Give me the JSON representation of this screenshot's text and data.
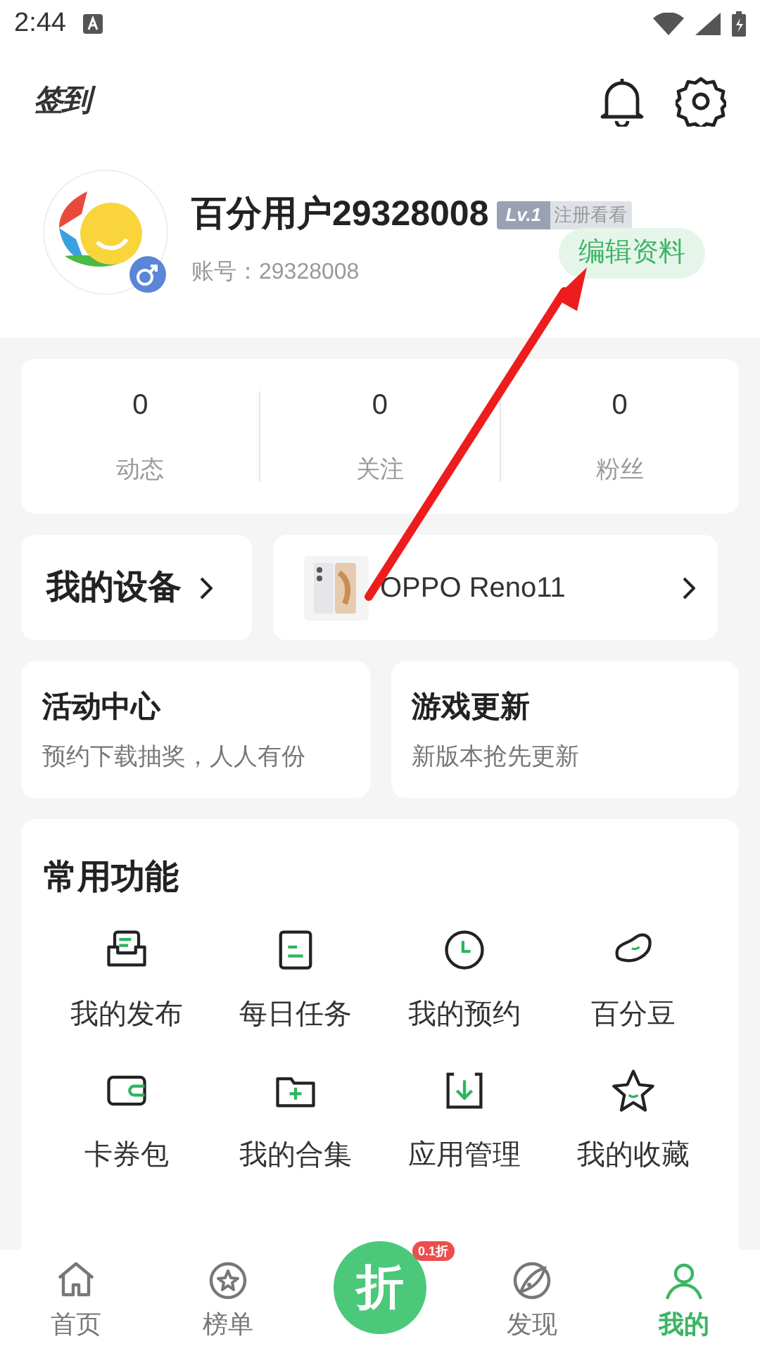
{
  "status_bar": {
    "time": "2:44"
  },
  "header": {
    "checkin_logo": "签到"
  },
  "profile": {
    "name": "百分用户29328008",
    "level": "Lv.1",
    "level_tag": "注册看看",
    "account": "账号：29328008",
    "edit_button": "编辑资料"
  },
  "stats": [
    {
      "value": "0",
      "label": "动态"
    },
    {
      "value": "0",
      "label": "关注"
    },
    {
      "value": "0",
      "label": "粉丝"
    }
  ],
  "devices": {
    "title": "我的设备",
    "device_name": "OPPO Reno11"
  },
  "promo_cards": [
    {
      "title": "活动中心",
      "subtitle": "预约下载抽奖，人人有份"
    },
    {
      "title": "游戏更新",
      "subtitle": "新版本抢先更新"
    }
  ],
  "common_functions": {
    "title": "常用功能",
    "items": [
      {
        "label": "我的发布",
        "kind": "tray"
      },
      {
        "label": "每日任务",
        "kind": "doc"
      },
      {
        "label": "我的预约",
        "kind": "clock"
      },
      {
        "label": "百分豆",
        "kind": "bean"
      },
      {
        "label": "卡券包",
        "kind": "wallet"
      },
      {
        "label": "我的合集",
        "kind": "folder"
      },
      {
        "label": "应用管理",
        "kind": "download"
      },
      {
        "label": "我的收藏",
        "kind": "star"
      }
    ]
  },
  "bottom_nav": [
    {
      "label": "首页",
      "kind": "home",
      "selected": false
    },
    {
      "label": "榜单",
      "kind": "rank",
      "selected": false
    },
    {
      "label": "折",
      "badge": "0.1折",
      "kind": "center",
      "selected": false
    },
    {
      "label": "发现",
      "kind": "discover",
      "selected": false
    },
    {
      "label": "我的",
      "kind": "me",
      "selected": true
    }
  ]
}
